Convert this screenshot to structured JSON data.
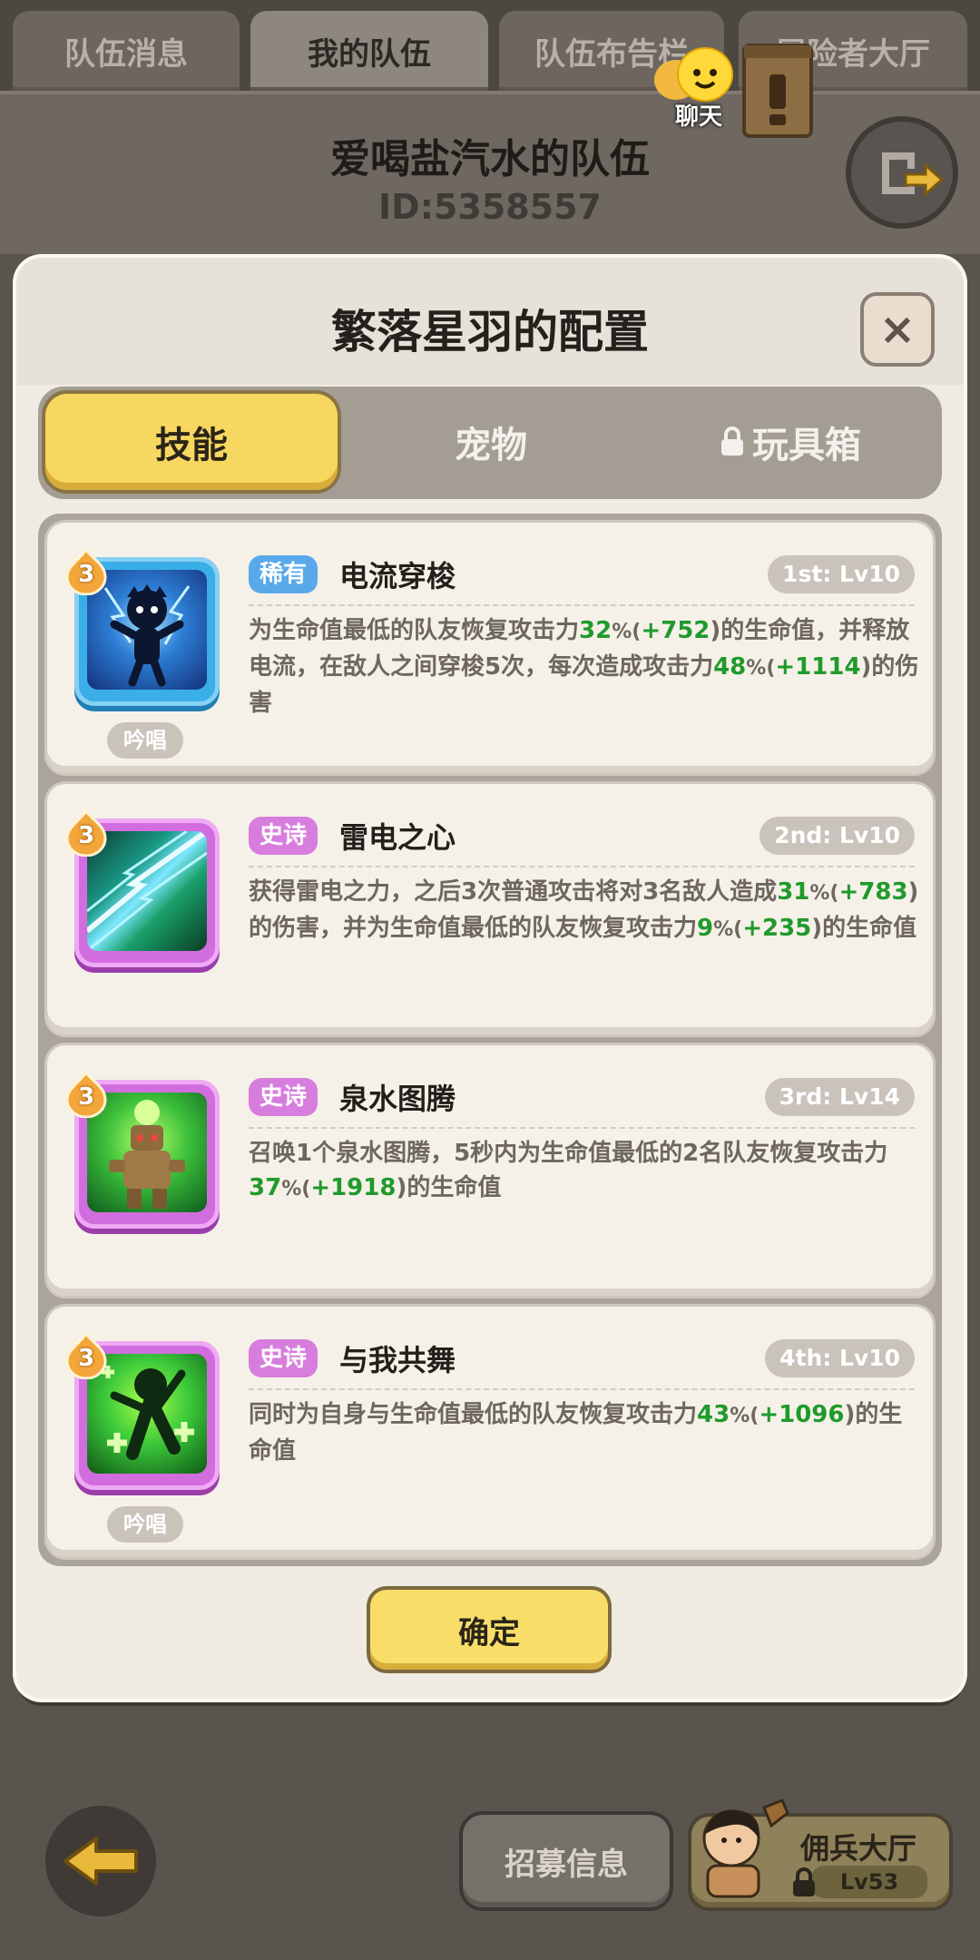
{
  "top_tabs": [
    "队伍消息",
    "我的队伍",
    "队伍布告栏",
    "冒险者大厅"
  ],
  "team": {
    "name": "爱喝盐汽水的队伍",
    "id": "ID:5358557"
  },
  "chat_label": "聊天",
  "modal": {
    "title": "繁落星羽的配置",
    "close": "×",
    "tabs": [
      "技能",
      "宠物",
      "玩具箱"
    ],
    "confirm": "确定"
  },
  "skills": [
    {
      "level": "3",
      "rarity": "稀有",
      "name": "电流穿梭",
      "rank": "1st: Lv10",
      "chant": "吟唱",
      "desc": [
        "为生命值最低的队友恢复攻击力",
        "32",
        "%(",
        "+752",
        ")的生命值，并释放电流，在敌人之间穿梭5次，每次造成攻击力",
        "48",
        "%(",
        "+1114",
        ")的伤害"
      ]
    },
    {
      "level": "3",
      "rarity": "史诗",
      "name": "雷电之心",
      "rank": "2nd: Lv10",
      "chant": "",
      "desc": [
        "获得雷电之力，之后3次普通攻击将对3名敌人造成",
        "31",
        "%(",
        "+783",
        ")的伤害，并为生命值最低的队友恢复攻击力",
        "9",
        "%(",
        "+235",
        ")的生命值"
      ]
    },
    {
      "level": "3",
      "rarity": "史诗",
      "name": "泉水图腾",
      "rank": "3rd: Lv14",
      "chant": "",
      "desc": [
        "召唤1个泉水图腾，5秒内为生命值最低的2名队友恢复攻击力",
        "37",
        "%(",
        "+1918",
        ")的生命值",
        "",
        "",
        "",
        ""
      ]
    },
    {
      "level": "3",
      "rarity": "史诗",
      "name": "与我共舞",
      "rank": "4th: Lv10",
      "chant": "吟唱",
      "desc": [
        "同时为自身与生命值最低的队友恢复攻击力",
        "43",
        "%(",
        "+1096",
        ")的生命值",
        "",
        "",
        "",
        ""
      ]
    }
  ],
  "bottom": {
    "recruit": "招募信息",
    "mercenary": "佣兵大厅",
    "merc_level": "Lv53"
  },
  "colors": {
    "rare": "#59a9ea",
    "epic": "#d77ddd",
    "highlight": "#1f9a2c",
    "confirm": "#f8dd69"
  },
  "icons": {
    "skill_1": "electric-figure-icon",
    "skill_2": "lightning-streak-icon",
    "skill_3": "totem-icon",
    "skill_4": "dancer-heal-icon",
    "lock": "lock-icon",
    "back": "back-arrow-icon",
    "exit": "exit-icon",
    "scroll": "scroll-icon",
    "chat": "chat-bubble-icon"
  }
}
